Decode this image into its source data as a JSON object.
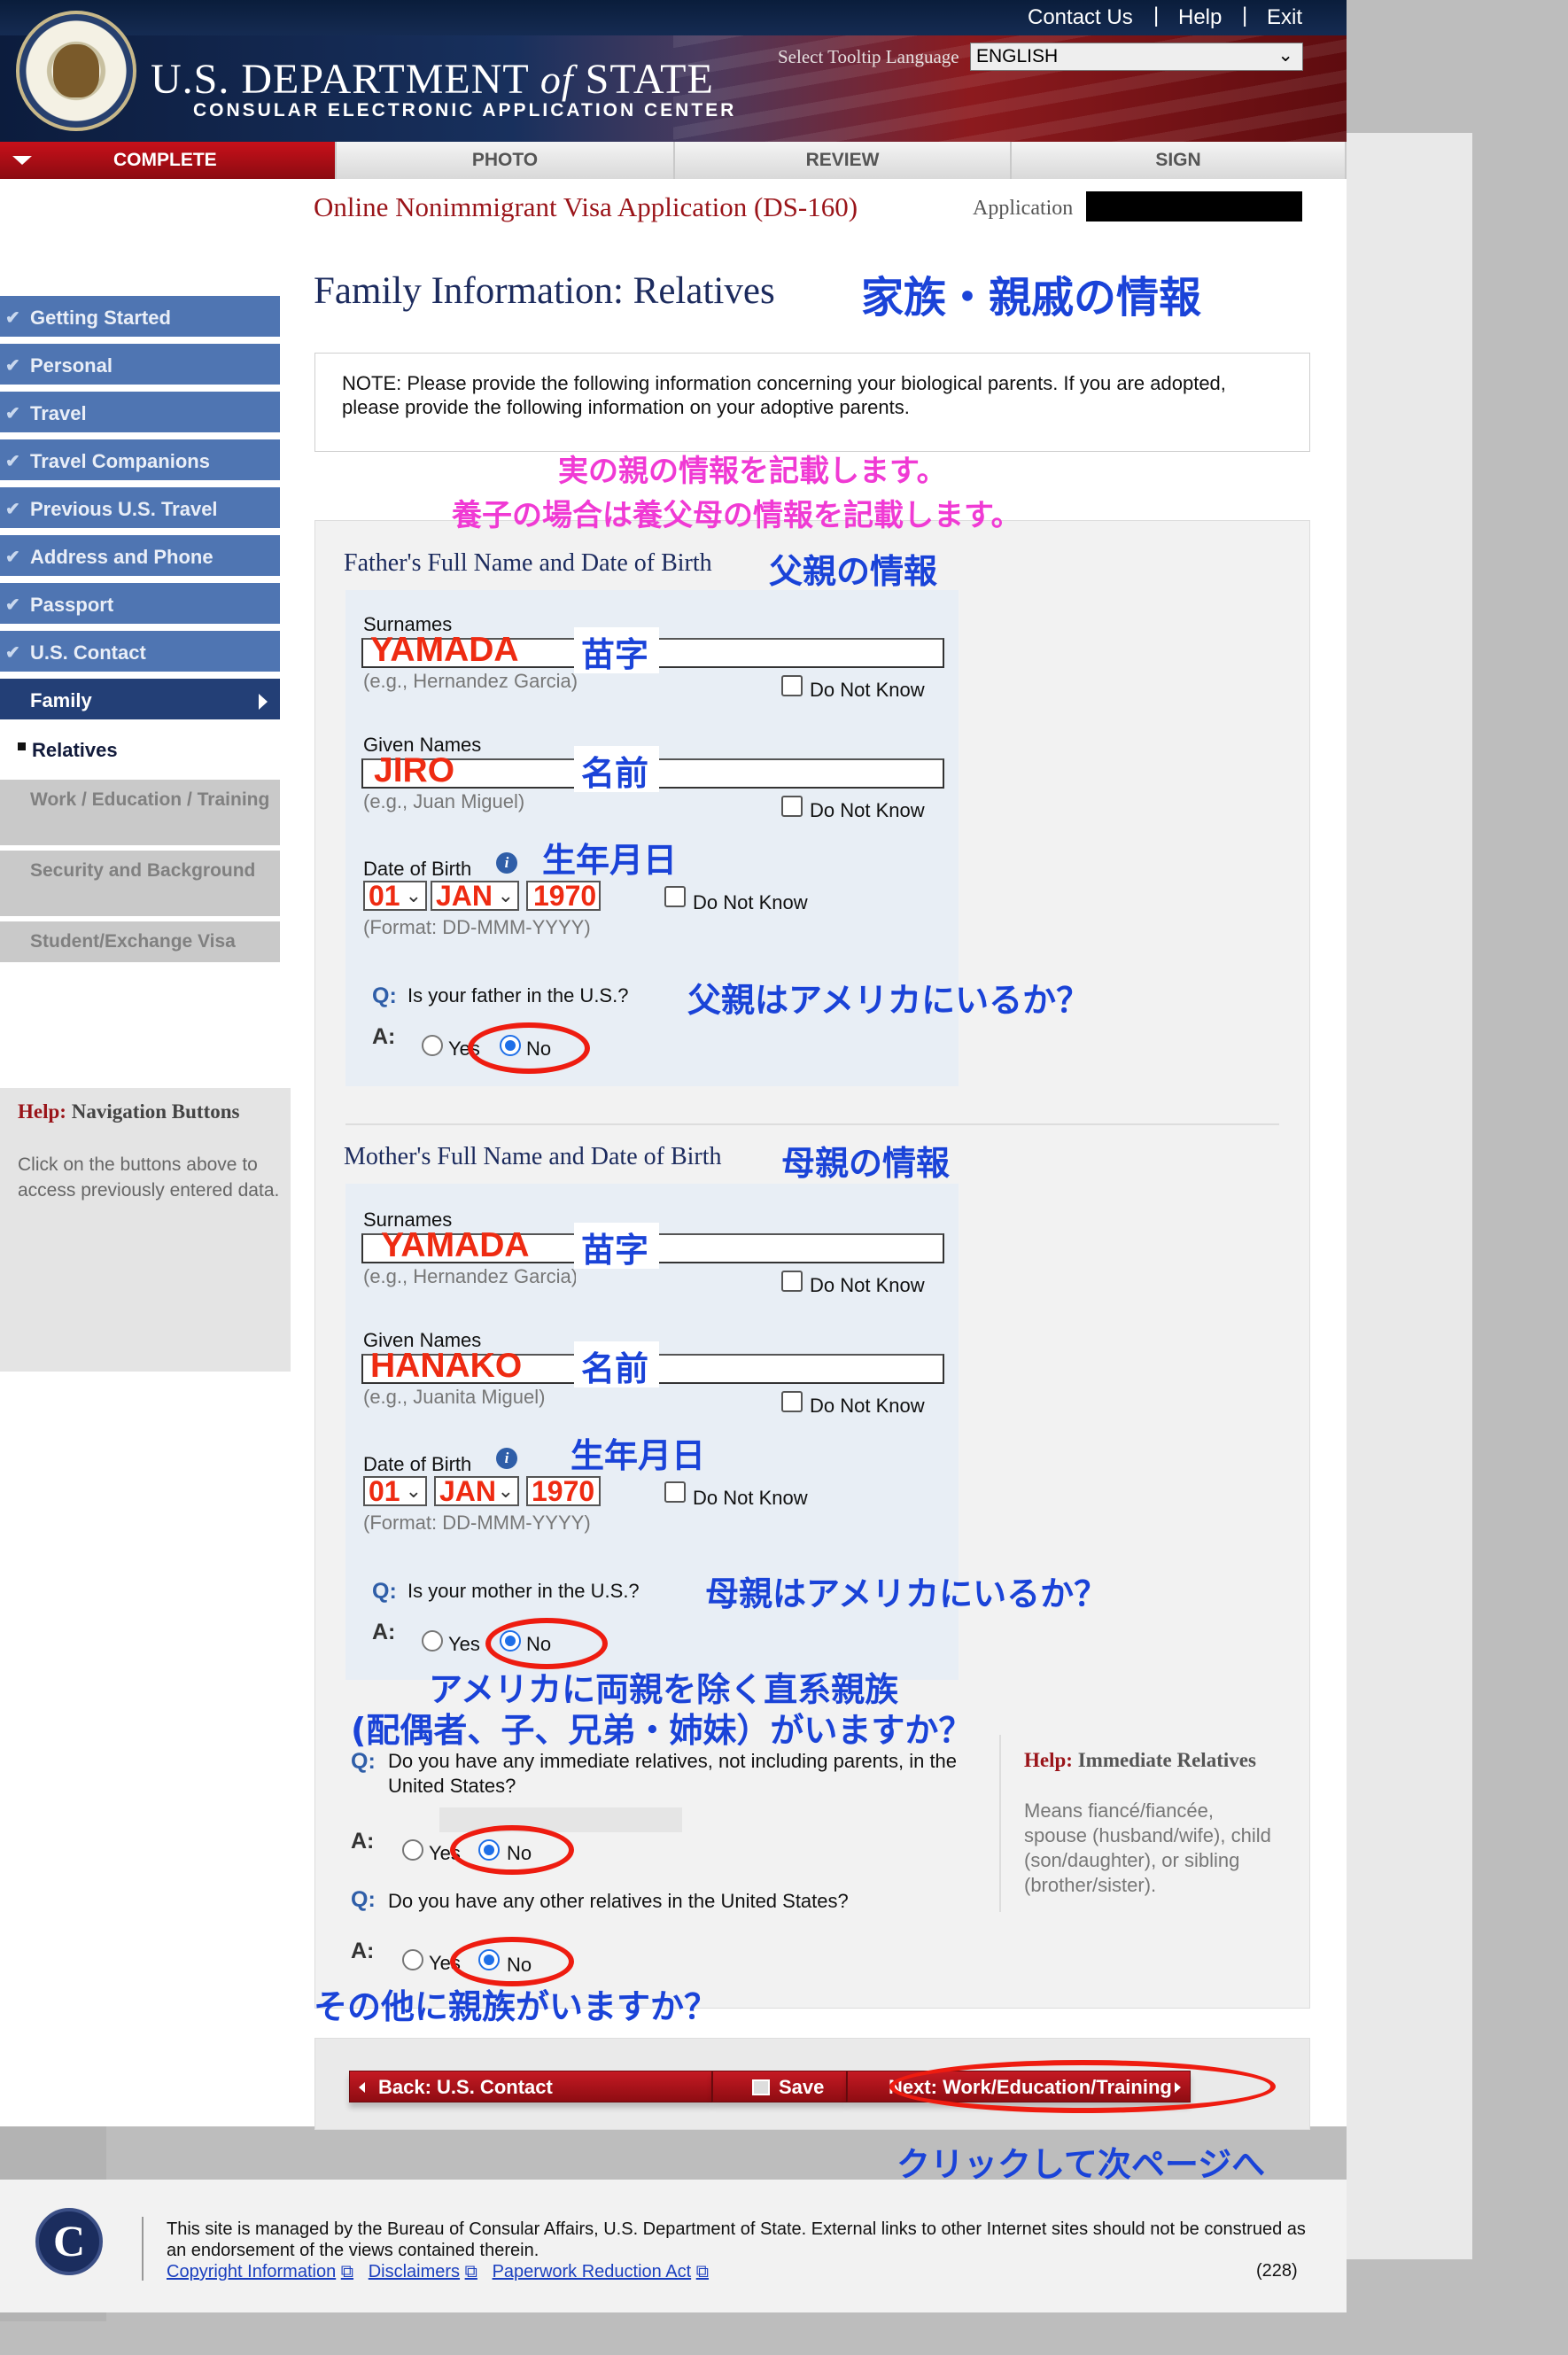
{
  "header": {
    "links": [
      "Contact Us",
      "Help",
      "Exit"
    ],
    "separator": "|",
    "dept_main": "U.S. DEPARTMENT",
    "dept_of": "of",
    "dept_state": "STATE",
    "subtitle": "CONSULAR ELECTRONIC APPLICATION CENTER",
    "tooltip_label": "Select Tooltip Language",
    "language": "ENGLISH",
    "chevron": "⌄"
  },
  "tabs": [
    "COMPLETE",
    "PHOTO",
    "REVIEW",
    "SIGN"
  ],
  "app": {
    "title": "Online Nonimmigrant Visa Application (DS-160)",
    "id_label": "Application"
  },
  "sidebar": {
    "check": "✔",
    "items": [
      "Getting Started",
      "Personal",
      "Travel",
      "Travel Companions",
      "Previous U.S. Travel",
      "Address and Phone",
      "Passport",
      "U.S. Contact"
    ],
    "current": "Family",
    "sub": "Relatives",
    "gray": [
      "Work / Education / Training",
      "Security and Background",
      "Student/Exchange Visa"
    ]
  },
  "help_nav": {
    "prefix": "Help:",
    "title": "Navigation Buttons",
    "body": "Click on the buttons above to access previously entered data."
  },
  "page": {
    "title": "Family Information: Relatives",
    "jp_title": "家族・親戚の情報"
  },
  "note": {
    "text": "NOTE: Please provide the following information concerning your biological parents. If you are adopted, please provide the following information on your adoptive parents.",
    "jp1": "実の親の情報を記載します。",
    "jp2": "養子の場合は養父母の情報を記載します。"
  },
  "father": {
    "title": "Father's Full Name and Date of Birth",
    "jp_title": "父親の情報",
    "surname_label": "Surnames",
    "surname": "YAMADA",
    "surname_hint": "(e.g., Hernandez Garcia)",
    "jp_surname": "苗字",
    "given_label": "Given Names",
    "given": "JIRO",
    "given_hint": "(e.g., Juan Miguel)",
    "jp_given": "名前",
    "dob_label": "Date of Birth",
    "jp_dob": "生年月日",
    "day": "01",
    "month": "JAN",
    "year": "1970",
    "dob_hint": "(Format: DD-MMM-YYYY)",
    "question": "Is your father in the U.S.?",
    "jp_question": "父親はアメリカにいるか？"
  },
  "mother": {
    "title": "Mother's Full Name and Date of Birth",
    "jp_title": "母親の情報",
    "surname_label": "Surnames",
    "surname": "YAMADA",
    "surname_hint": "(e.g., Hernandez Garcia)",
    "jp_surname": "苗字",
    "given_label": "Given Names",
    "given": "HANAKO",
    "given_hint": "(e.g., Juanita Miguel)",
    "jp_given": "名前",
    "dob_label": "Date of Birth",
    "jp_dob": "生年月日",
    "day": "01",
    "month": "JAN",
    "year": "1970",
    "dob_hint": "(Format: DD-MMM-YYYY)",
    "question": "Is your mother in the U.S.?",
    "jp_question": "母親はアメリカにいるか？"
  },
  "common": {
    "do_not_know": "Do Not Know",
    "q": "Q:",
    "a": "A:",
    "yes": "Yes",
    "no": "No",
    "info": "i",
    "dropdown": "⌄"
  },
  "relatives": {
    "jp_line1": "アメリカに両親を除く直系親族",
    "jp_line2": "(配偶者、子、兄弟・姉妹）がいますか？",
    "q1": "Do you have any immediate relatives, not including parents, in the United States?",
    "q2": "Do you have any other relatives in the United States?",
    "jp_other": "その他に親族がいますか？"
  },
  "help_rel": {
    "prefix": "Help:",
    "title": "Immediate Relatives",
    "body": "Means fiancé/fiancée, spouse (husband/wife), child (son/daughter), or sibling (brother/sister)."
  },
  "buttons": {
    "back": "Back: U.S. Contact",
    "save": "Save",
    "next": "Next: Work/Education/Training",
    "jp_click": "クリックして次ページへ"
  },
  "footer": {
    "logo": "C",
    "text": "This site is managed by the Bureau of Consular Affairs, U.S. Department of State. External links to other Internet sites should not be construed as an endorsement of the views contained therein.",
    "links": [
      "Copyright Information",
      "Disclaimers",
      "Paperwork Reduction Act"
    ],
    "ext": "⧉",
    "count": "(228)"
  },
  "colors": {
    "brand_red": "#9a1419",
    "nav_blue": "#4f75b2",
    "annotation_blue": "#1a43d8",
    "annotation_red": "#ee2b12",
    "annotation_pink": "#f03ad4"
  }
}
